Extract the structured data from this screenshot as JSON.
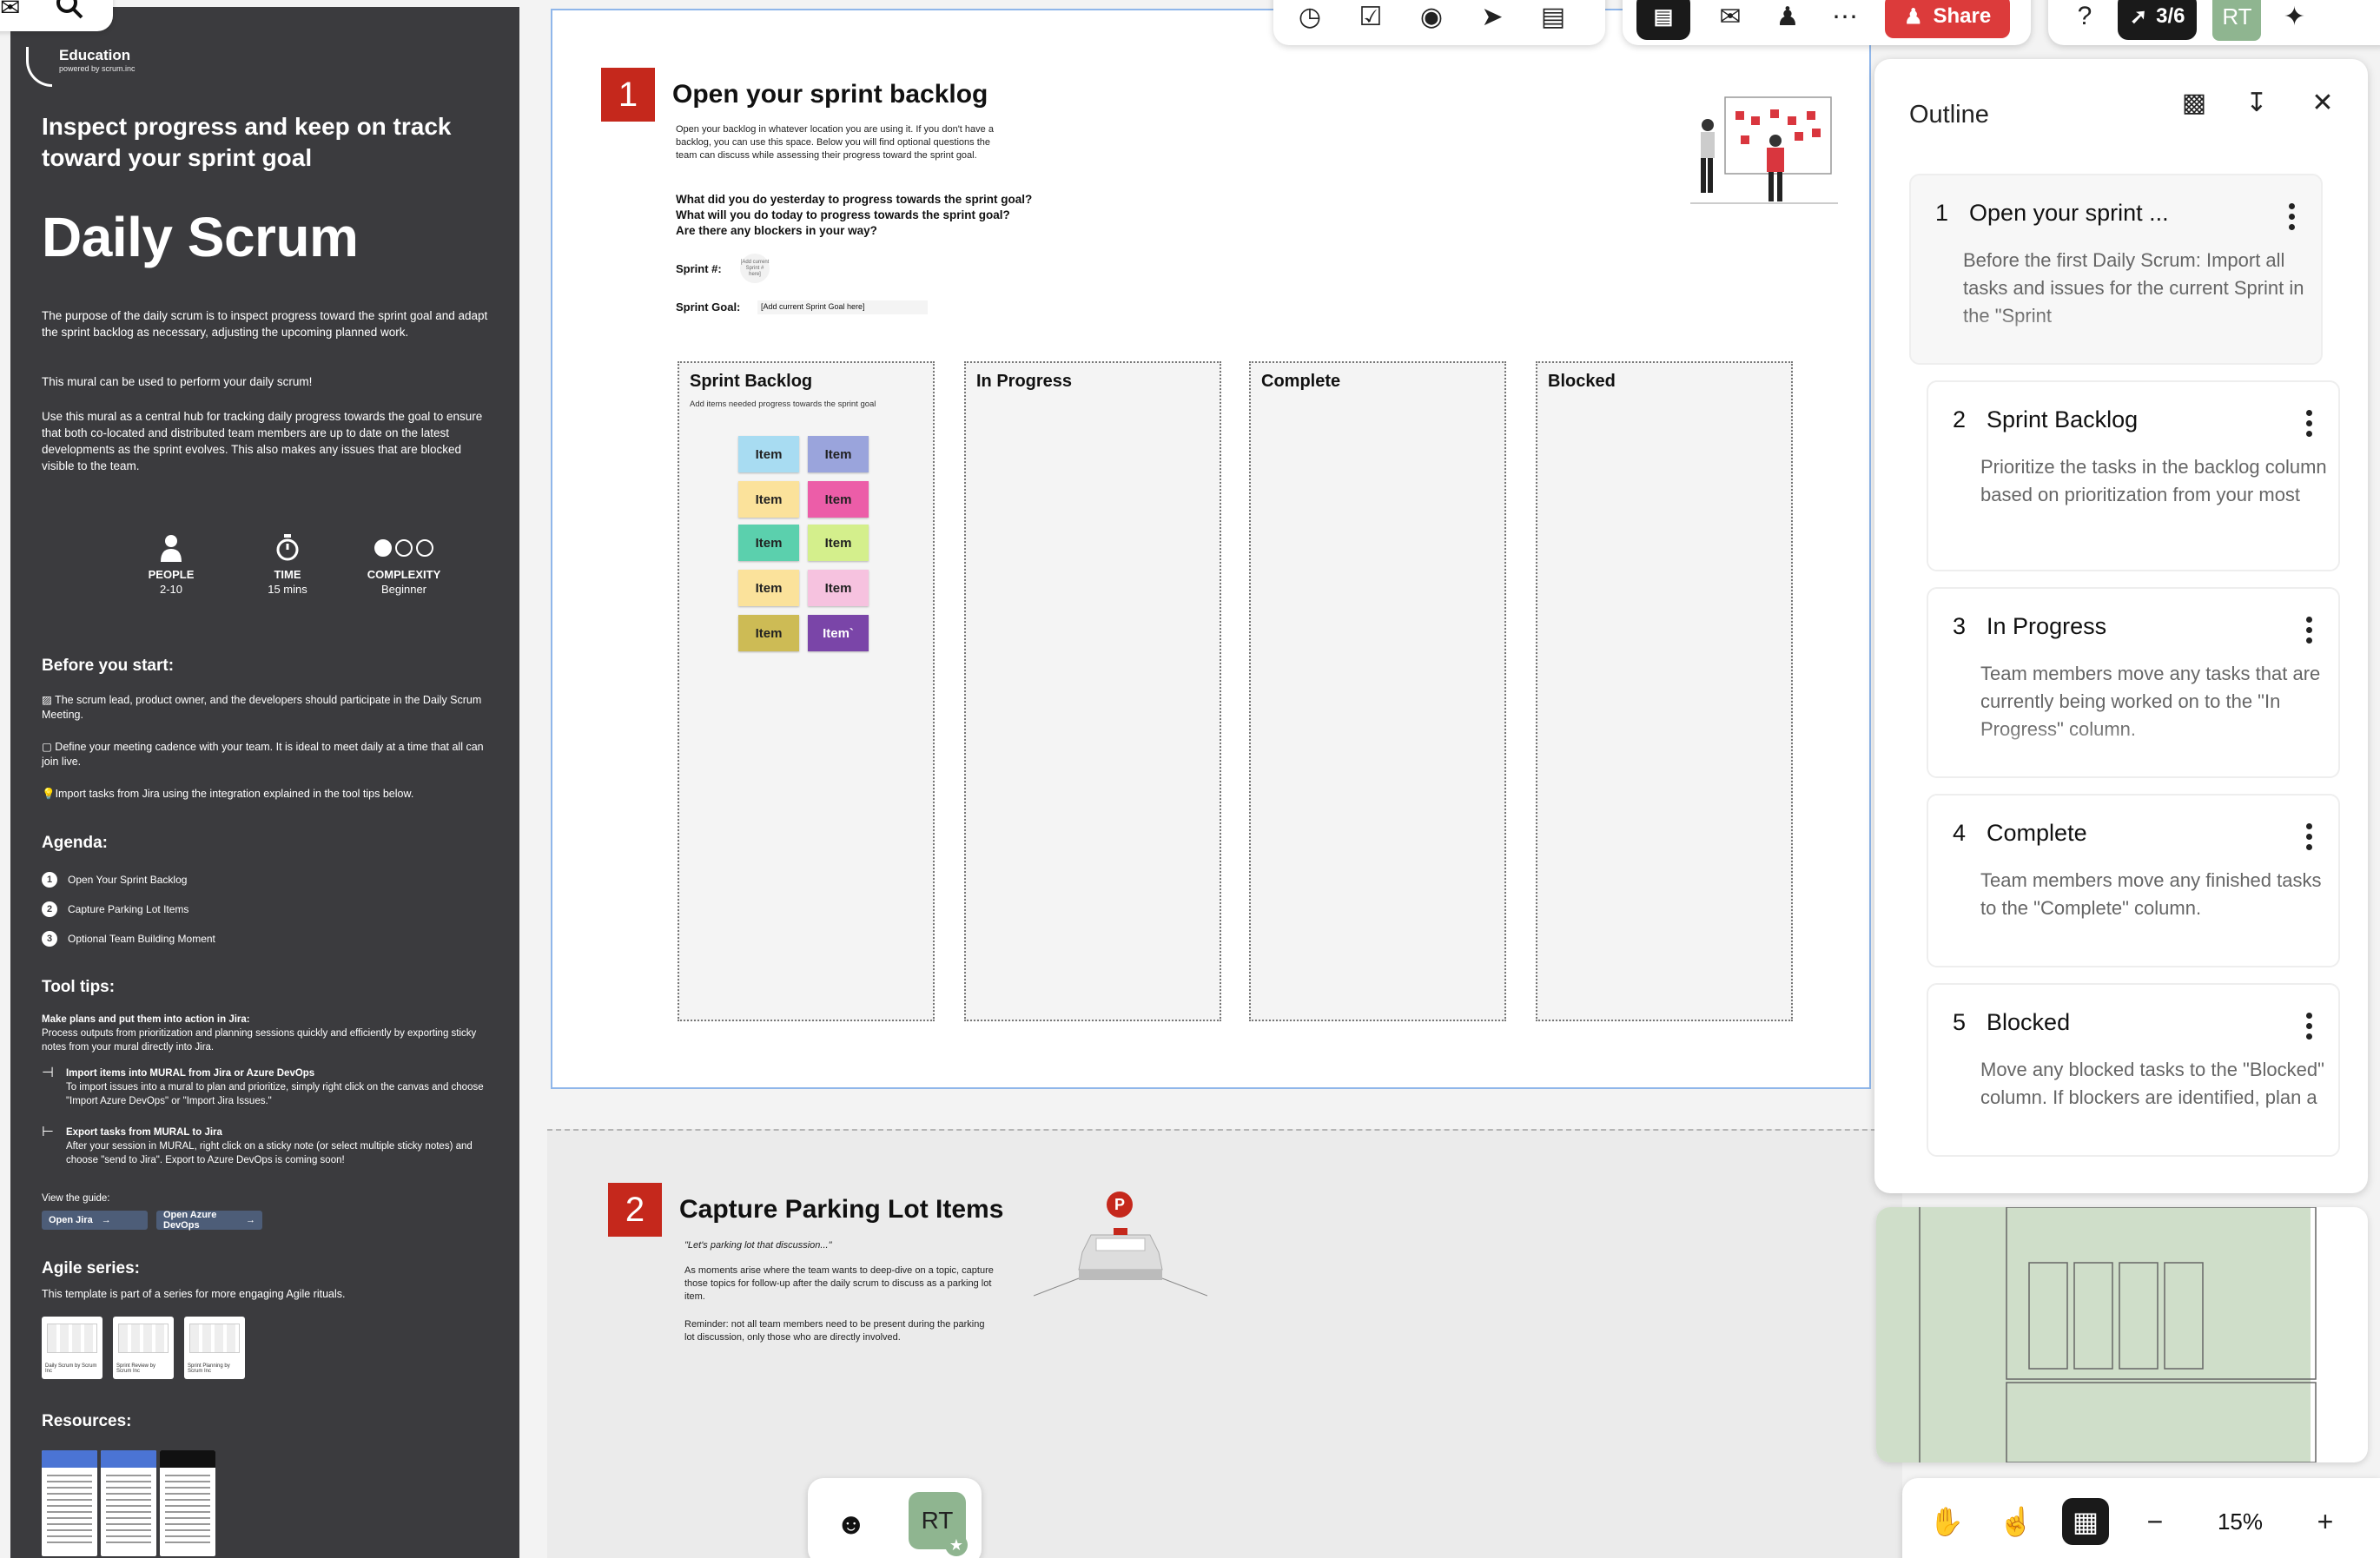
{
  "left_panel": {
    "logo_title": "Education",
    "logo_sub": "powered by scrum.inc",
    "subtitle": "Inspect progress and keep on track toward your sprint goal",
    "title": "Daily Scrum",
    "para1": "The purpose of the daily scrum is to inspect progress toward the sprint goal and adapt the sprint backlog as necessary, adjusting the upcoming planned work.",
    "para2": "This mural can be used to perform your daily scrum!",
    "para3": "Use this mural as a central hub for tracking daily progress towards the goal to ensure that both co-located and distributed team members are up to date on the latest developments as the sprint evolves. This also makes any issues that are blocked visible to the team.",
    "stats": [
      {
        "icon": "person-icon",
        "label": "PEOPLE",
        "value": "2-10"
      },
      {
        "icon": "stopwatch-icon",
        "label": "TIME",
        "value": "15 mins"
      },
      {
        "icon": "complexity-dots-icon",
        "label": "COMPLEXITY",
        "value": "Beginner"
      }
    ],
    "before_heading": "Before you start:",
    "before_items": [
      "The scrum lead, product owner, and the developers should participate in the Daily Scrum Meeting.",
      "Define your meeting cadence with your team. It is ideal to meet daily at a time that all can join live.",
      "Import tasks from Jira using the integration explained in the tool tips below."
    ],
    "agenda_heading": "Agenda:",
    "agenda": [
      "Open Your Sprint Backlog",
      "Capture Parking Lot Items",
      "Optional Team Building Moment"
    ],
    "tooltips_heading": "Tool tips:",
    "tip_title": "Make plans and put them into action in Jira:",
    "tip_body": "Process outputs from prioritization and planning sessions quickly and efficiently by exporting sticky notes from your mural directly into Jira.",
    "import_title": "Import items into MURAL from Jira or Azure DevOps",
    "import_body": "To import issues into a mural to plan and prioritize, simply right click on the canvas and choose \"Import Azure DevOps\" or \"Import Jira Issues.\"",
    "export_title": "Export tasks from MURAL to Jira",
    "export_body": "After your session in MURAL, right click on a sticky note (or select multiple sticky notes) and choose \"send to Jira\". Export to Azure DevOps is coming soon!",
    "view_guide": "View the guide:",
    "btn_jira": "Open Jira",
    "btn_azure": "Open Azure DevOps",
    "agile_heading": "Agile series:",
    "agile_sub": "This template is part of a series for more engaging Agile rituals.",
    "agile_thumbs": [
      "Daily Scrum by Scrum Inc",
      "Sprint Review by Scrum Inc",
      "Sprint Planning by Scrum Inc"
    ],
    "resources_heading": "Resources:"
  },
  "section1": {
    "number": "1",
    "title": "Open your sprint backlog",
    "intro": "Open your backlog in whatever location you are using it. If you don't have a backlog, you can use this space. Below you will find optional questions the team can discuss while assessing their progress toward the sprint goal.",
    "q1": "What did you do yesterday to progress towards the sprint goal?",
    "q2": "What will you do today to progress towards the sprint goal?",
    "q3": "Are there any blockers in your way?",
    "sprint_label": "Sprint #:",
    "sprint_placeholder": "[Add current Sprint # here]",
    "goal_label": "Sprint Goal:",
    "goal_placeholder": "[Add current Sprint Goal here]",
    "columns": [
      {
        "title": "Sprint Backlog",
        "sub": "Add items needed progress towards the sprint goal"
      },
      {
        "title": "In Progress",
        "sub": ""
      },
      {
        "title": "Complete",
        "sub": ""
      },
      {
        "title": "Blocked",
        "sub": ""
      }
    ],
    "stickies": [
      {
        "label": "Item",
        "color": "#a8dcf2"
      },
      {
        "label": "Item",
        "color": "#9aa4dc"
      },
      {
        "label": "Item",
        "color": "#fbe29b"
      },
      {
        "label": "Item",
        "color": "#ec5da8"
      },
      {
        "label": "Item",
        "color": "#5bd0ad"
      },
      {
        "label": "Item",
        "color": "#d4ef8c"
      },
      {
        "label": "Item",
        "color": "#fbe29b"
      },
      {
        "label": "Item",
        "color": "#f6c2df"
      },
      {
        "label": "Item",
        "color": "#cdbb55"
      },
      {
        "label": "Item`",
        "color": "#7a45a8"
      }
    ]
  },
  "section2": {
    "number": "2",
    "title": "Capture Parking Lot Items",
    "quote": "\"Let's parking lot that discussion...\"",
    "body1": "As moments arise where the team wants to deep-dive on a topic, capture those topics for follow-up after the daily scrum to discuss as a parking lot item.",
    "body2": "Reminder: not all team members need to be present during the parking lot discussion, only those who are directly involved.",
    "sign": "P"
  },
  "outline": {
    "title": "Outline",
    "items": [
      {
        "num": "1",
        "title": "Open your sprint ...",
        "body": "Before the first Daily Scrum: Import all tasks and issues for the current Sprint in the \"Sprint"
      },
      {
        "num": "2",
        "title": "Sprint Backlog",
        "body": "Prioritize the tasks in the backlog column based on prioritization from your most"
      },
      {
        "num": "3",
        "title": "In Progress",
        "body": "Team members move any tasks that are currently being worked on to the \"In Progress\" column."
      },
      {
        "num": "4",
        "title": "Complete",
        "body": "Team members move any finished tasks to the \"Complete\" column."
      },
      {
        "num": "5",
        "title": "Blocked",
        "body": "Move any blocked tasks to the \"Blocked\" column. If blockers are identified, plan a"
      }
    ]
  },
  "toolbar": {
    "share_label": "Share",
    "progress": "3/6",
    "avatar": "RT"
  },
  "bottom": {
    "avatar": "RT",
    "zoom": "15%"
  },
  "colors": {
    "accent_red": "#c5281c",
    "panel_dark": "#3b3b3e",
    "share_red": "#dc3b3b",
    "avatar_green": "#8fb590"
  }
}
